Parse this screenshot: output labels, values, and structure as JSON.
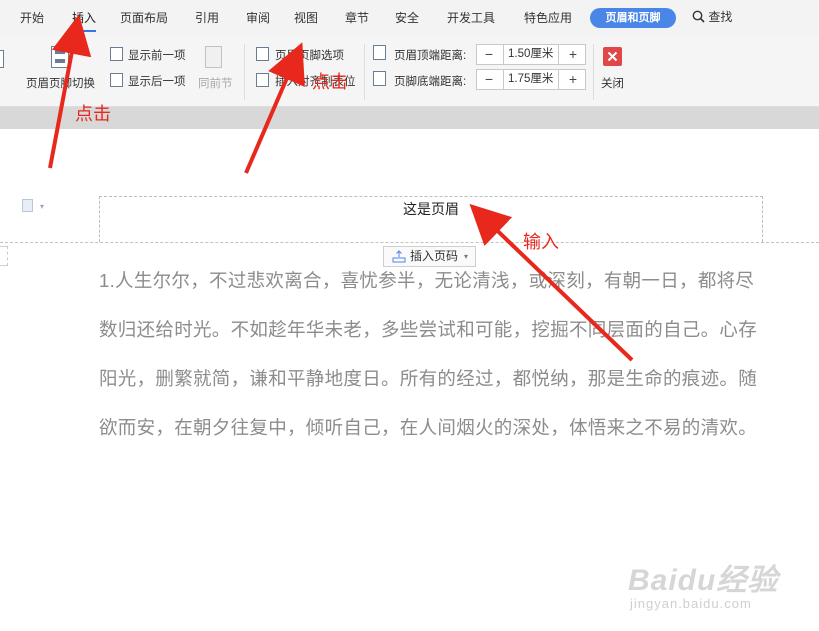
{
  "menu": {
    "items": [
      "开始",
      "插入",
      "页面布局",
      "引用",
      "审阅",
      "视图",
      "章节",
      "安全",
      "开发工具",
      "特色应用"
    ],
    "active_tab": "页眉和页脚",
    "search_label": "查找"
  },
  "ribbon": {
    "switch_label": "页眉页脚切换",
    "show_prev_label": "显示前一项",
    "show_next_label": "显示后一项",
    "same_as_prev_label": "同前节",
    "hf_options_label": "页眉页脚选项",
    "insert_align_tab_label": "插入对齐制表位",
    "header_top_label": "页眉顶端距离:",
    "header_top_value": "1.50厘米",
    "footer_bottom_label": "页脚底端距离:",
    "footer_bottom_value": "1.75厘米",
    "close_label": "关闭"
  },
  "document": {
    "header_text": "这是页眉",
    "insert_page_number_label": "插入页码",
    "body_text": "1.人生尔尔，不过悲欢离合，喜忧参半，无论清浅，或深刻，有朝一日，都将尽数归还给时光。不如趁年华未老，多些尝试和可能，挖掘不同层面的自己。心存阳光，删繁就简，谦和平静地度日。所有的经过，都悦纳，那是生命的痕迹。随欲而安，在朝夕往复中，倾听自己，在人间烟火的深处，体悟来之不易的清欢。"
  },
  "annotations": {
    "click_1": "点击",
    "click_2": "点击",
    "input": "输入",
    "color": "#e8281c"
  },
  "watermark": {
    "brand": "Baidu经验",
    "url": "jingyan.baidu.com"
  },
  "colors": {
    "accent": "#4a86e8",
    "close": "#e04848"
  }
}
